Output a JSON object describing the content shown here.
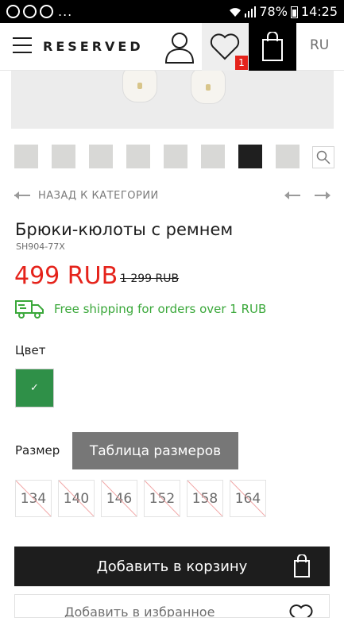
{
  "status_bar": {
    "dots": "...",
    "battery": "78%",
    "time": "14:25"
  },
  "header": {
    "logo": "RESERVED",
    "wishlist_count": "1",
    "language": "RU"
  },
  "gallery": {
    "thumb_count": 8,
    "active_index": 6
  },
  "navigation": {
    "back_label": "НАЗАД К КАТЕГОРИИ"
  },
  "product": {
    "title": "Брюки-кюлоты с ремнем",
    "sku": "SH904-77X",
    "price": "499 RUB",
    "old_price": "1 299 RUB",
    "shipping": "Free shipping for orders over 1 RUB"
  },
  "color": {
    "label": "Цвет",
    "selected_color": "#2f9048",
    "check": "✓"
  },
  "size": {
    "label": "Размер",
    "table_button": "Таблица размеров",
    "options": [
      "134",
      "140",
      "146",
      "152",
      "158",
      "164"
    ]
  },
  "actions": {
    "add_to_cart": "Добавить в корзину",
    "add_to_favorites": "Добавить в избранное"
  },
  "colors": {
    "accent_red": "#e5231b",
    "shipping_green": "#3aa83a",
    "dark": "#1d1d1d"
  }
}
